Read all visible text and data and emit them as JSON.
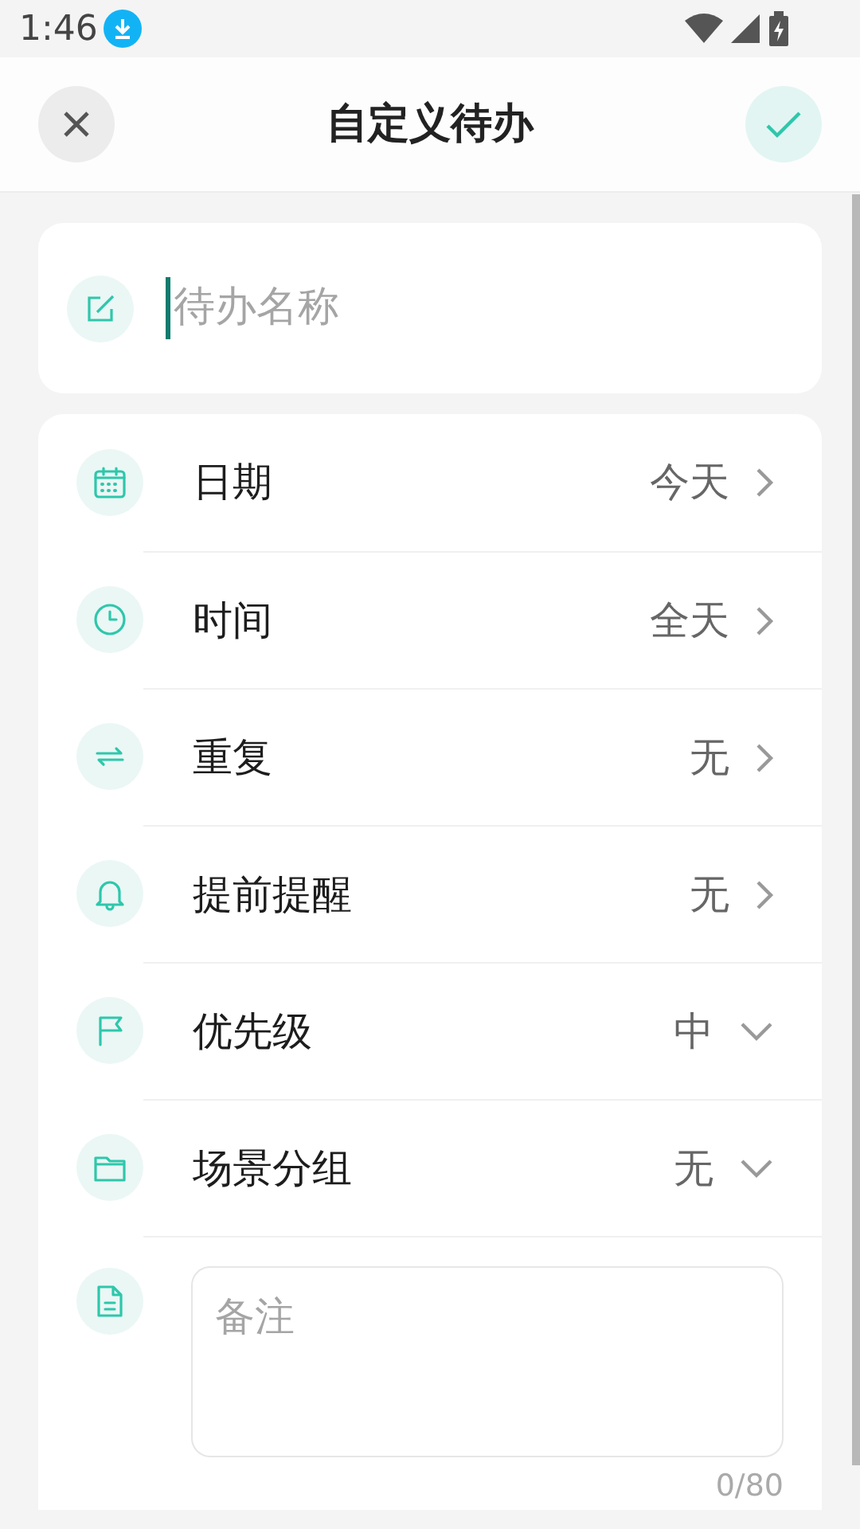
{
  "status_bar": {
    "time": "1:46"
  },
  "header": {
    "title": "自定义待办"
  },
  "name_field": {
    "placeholder": "待办名称"
  },
  "settings": [
    {
      "label": "日期",
      "value": "今天",
      "kind": "picker"
    },
    {
      "label": "时间",
      "value": "全天",
      "kind": "picker"
    },
    {
      "label": "重复",
      "value": "无",
      "kind": "picker"
    },
    {
      "label": "提前提醒",
      "value": "无",
      "kind": "picker"
    },
    {
      "label": "优先级",
      "value": "中",
      "kind": "dropdown"
    },
    {
      "label": "场景分组",
      "value": "无",
      "kind": "dropdown"
    }
  ],
  "notes": {
    "placeholder": "备注",
    "counter": "0/80"
  }
}
